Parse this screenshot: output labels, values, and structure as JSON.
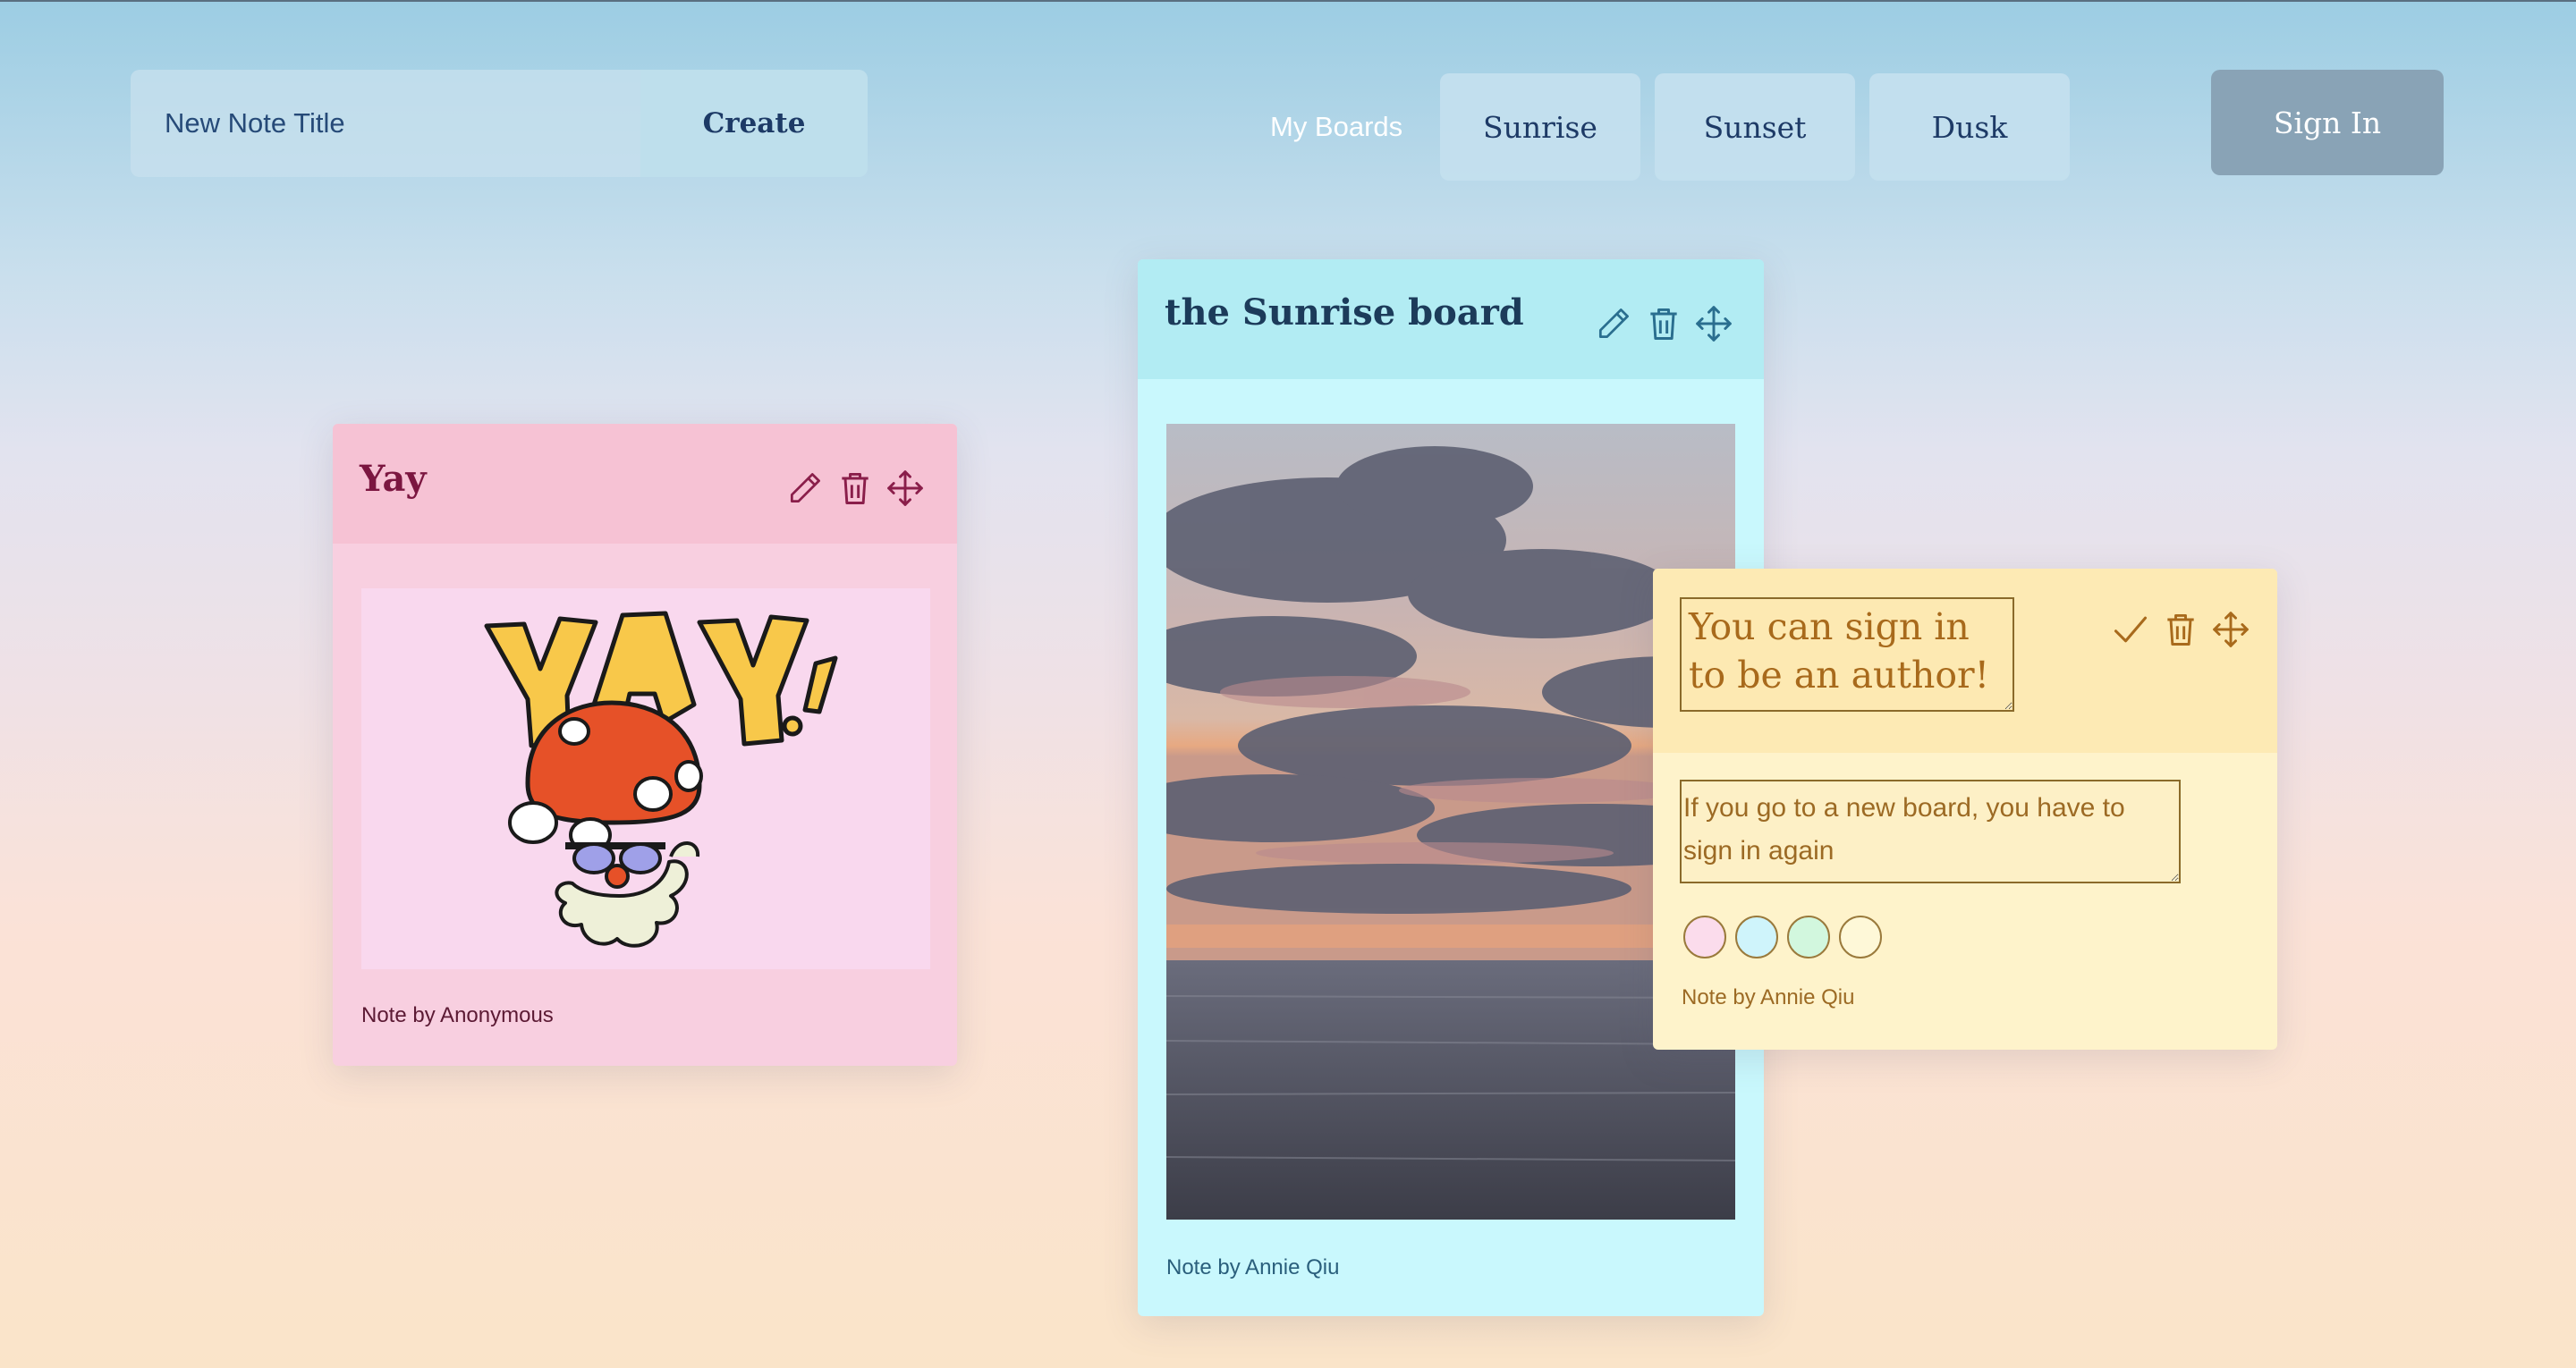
{
  "header": {
    "new_note_placeholder": "New Note Title",
    "create_label": "Create",
    "my_boards_label": "My Boards",
    "boards": [
      "Sunrise",
      "Sunset",
      "Dusk"
    ],
    "sign_in_label": "Sign In"
  },
  "notes": [
    {
      "title": "Yay",
      "image": "yay-mushroom-sticker",
      "byline": "Note by Anonymous",
      "color": "#f8cfe0"
    },
    {
      "title": "the Sunrise board",
      "image": "sunset-clouds-over-ocean",
      "byline": "Note by Annie Qiu",
      "color": "#c9f8fd"
    },
    {
      "title": "You can sign in to be an author!",
      "text": "If you go to a new board, you have to sign in again",
      "byline": "Note by Annie Qiu",
      "color": "#fef3cb",
      "swatches": [
        "#fbdcec",
        "#cff4fb",
        "#d2f7de",
        "#fef8d8"
      ]
    }
  ],
  "icons": [
    "pencil-icon",
    "trash-icon",
    "move-icon",
    "check-icon"
  ]
}
